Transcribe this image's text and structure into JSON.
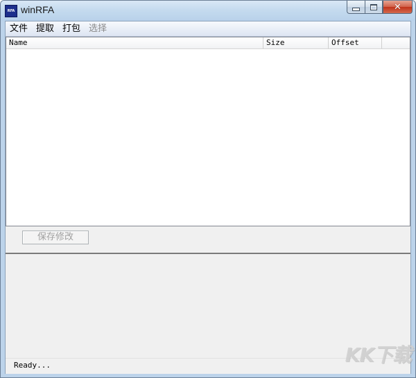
{
  "window": {
    "title": "winRFA",
    "icon_label": "RFA"
  },
  "menu": {
    "items": [
      {
        "label": "文件",
        "enabled": true
      },
      {
        "label": "提取",
        "enabled": true
      },
      {
        "label": "打包",
        "enabled": true
      },
      {
        "label": "选择",
        "enabled": false
      }
    ]
  },
  "list": {
    "columns": [
      "Name",
      "Size",
      "Offset"
    ],
    "rows": []
  },
  "actions": {
    "save_label": "保存修改",
    "save_enabled": false
  },
  "status": {
    "text": "Ready..."
  },
  "watermark": {
    "text": "KK下载"
  },
  "colors": {
    "title_bar": "#c5dbef",
    "close_button": "#c0331a",
    "menu_bar": "#dde5f2",
    "client_background": "#f0f0f0"
  }
}
